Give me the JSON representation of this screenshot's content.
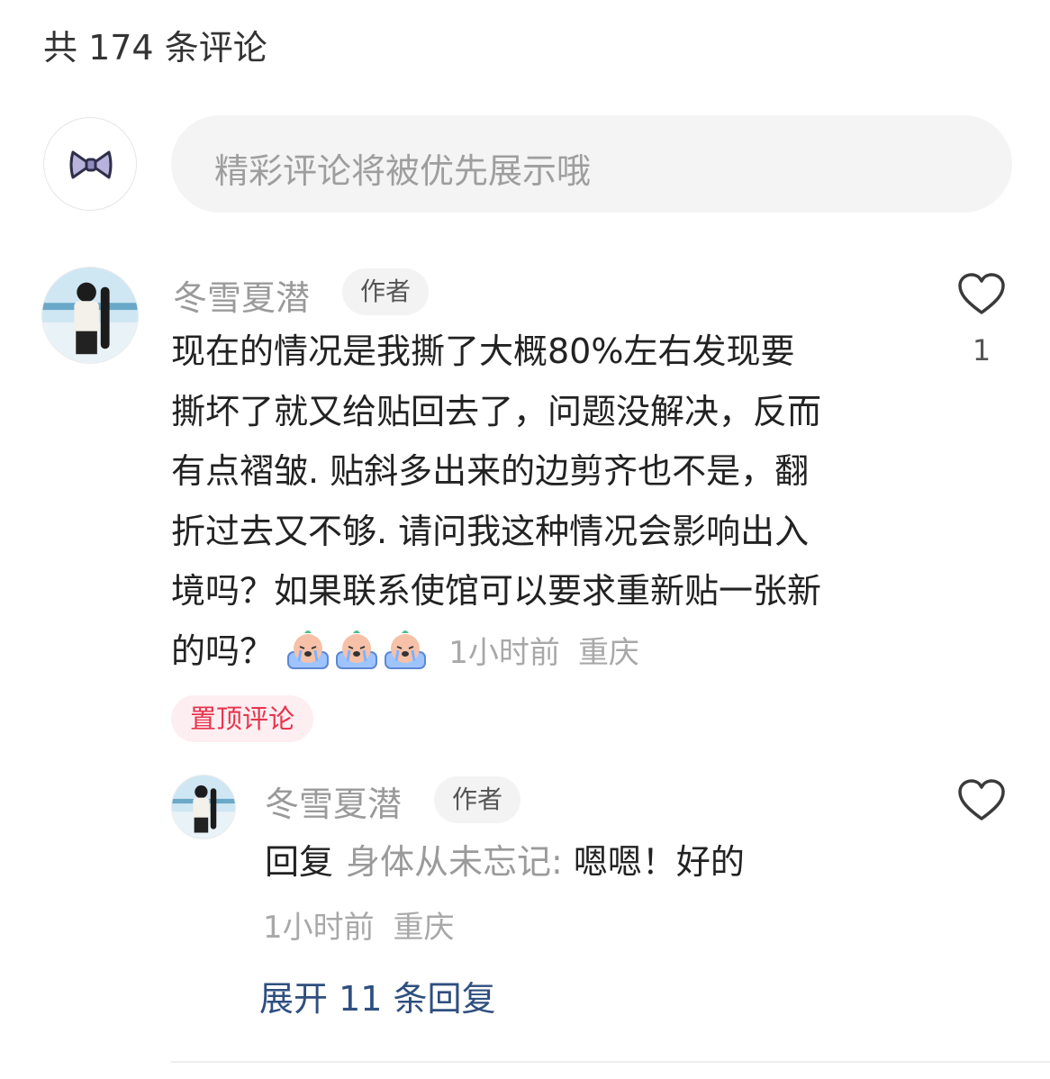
{
  "header": {
    "comment_count_label": "共 174 条评论"
  },
  "composer": {
    "placeholder": "精彩评论将被优先展示哦"
  },
  "comment": {
    "author": "冬雪夏潜",
    "badge": "作者",
    "text_lines": [
      "现在的情况是我撕了大概80%左右发现要",
      "撕坏了就又给贴回去了，问题没解决，反而",
      "有点褶皱. 贴斜多出来的边剪齐也不是，翻",
      "折过去又不够. 请问我这种情况会影响出入",
      "境吗？如果联系使馆可以要求重新贴一张新",
      "的吗？"
    ],
    "emojis": [
      "crying-emoji",
      "crying-emoji",
      "crying-emoji"
    ],
    "time": "1小时前",
    "location": "重庆",
    "pinned_label": "置顶评论",
    "like_count": "1"
  },
  "reply": {
    "author": "冬雪夏潜",
    "badge": "作者",
    "prefix": "回复",
    "target": "身体从未忘记:",
    "text": "嗯嗯！好的",
    "time": "1小时前",
    "location": "重庆"
  },
  "expand": {
    "label": "展开 11 条回复"
  },
  "colors": {
    "pinned_text": "#e8344e",
    "pinned_bg": "#fdeef1",
    "expand_link": "#2f4f7f",
    "input_bg": "#f4f4f4"
  }
}
